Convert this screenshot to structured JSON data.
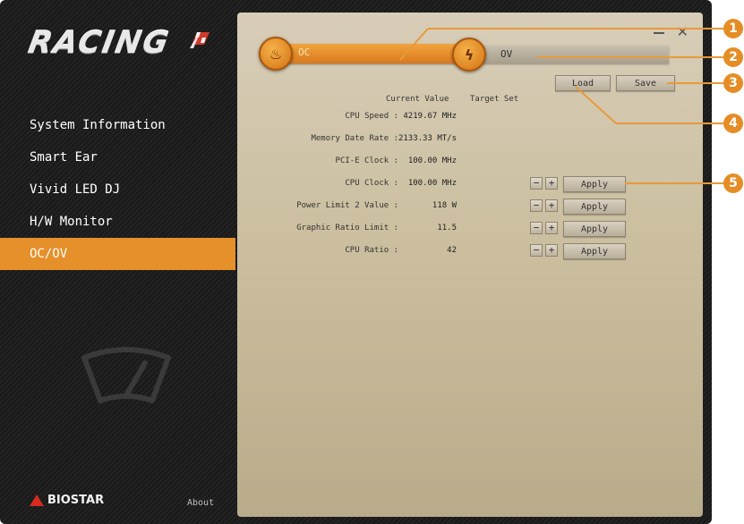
{
  "app": {
    "logo_text": "RACING"
  },
  "sidebar": {
    "items": [
      {
        "label": "System Information"
      },
      {
        "label": "Smart Ear"
      },
      {
        "label": "Vivid LED DJ"
      },
      {
        "label": "H/W Monitor"
      },
      {
        "label": "OC/OV",
        "active": true
      }
    ],
    "brand": "BIOSTAR",
    "about": "About"
  },
  "tabs": {
    "oc": "OC",
    "ov": "OV"
  },
  "toolbar": {
    "load": "Load",
    "save": "Save"
  },
  "table": {
    "headers": {
      "current": "Current Value",
      "target": "Target Set"
    },
    "rows": [
      {
        "label": "CPU Speed :",
        "value": "4219.67 MHz"
      },
      {
        "label": "Memory Date Rate :",
        "value": "2133.33 MT/s"
      },
      {
        "label": "PCI-E Clock :",
        "value": "100.00 MHz"
      },
      {
        "label": "CPU Clock :",
        "value": "100.00 MHz",
        "apply": "Apply"
      },
      {
        "label": "Power Limit 2 Value :",
        "value": "118 W",
        "apply": "Apply"
      },
      {
        "label": "Graphic Ratio Limit :",
        "value": "11.5",
        "apply": "Apply"
      },
      {
        "label": "CPU Ratio :",
        "value": "42",
        "apply": "Apply"
      }
    ]
  },
  "stepper": {
    "minus": "−",
    "plus": "+"
  },
  "callouts": [
    "1",
    "2",
    "3",
    "4",
    "5"
  ],
  "colors": {
    "accent": "#e5902b",
    "sidebar_bg": "#1e1e1e",
    "panel_bg": "#cbbf9f"
  }
}
